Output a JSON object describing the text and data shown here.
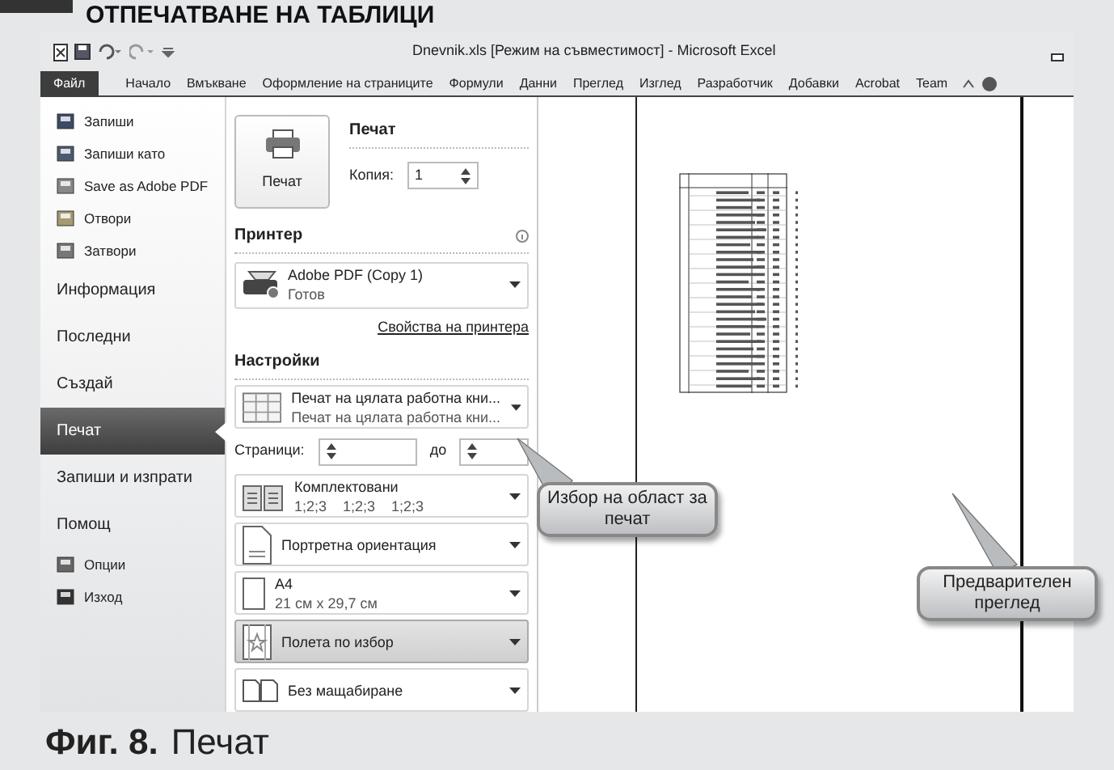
{
  "page_heading": "ОТПЕЧАТВАНЕ НА ТАБЛИЦИ",
  "window": {
    "title": "Dnevnik.xls  [Режим на съвместимост]  -  Microsoft Excel"
  },
  "ribbon_tabs": [
    {
      "label": "Файл",
      "selected": true
    },
    {
      "label": "Начало",
      "selected": false
    },
    {
      "label": "Вмъкване",
      "selected": false
    },
    {
      "label": "Оформление на страниците",
      "selected": false
    },
    {
      "label": "Формули",
      "selected": false
    },
    {
      "label": "Данни",
      "selected": false
    },
    {
      "label": "Преглед",
      "selected": false
    },
    {
      "label": "Изглед",
      "selected": false
    },
    {
      "label": "Разработчик",
      "selected": false
    },
    {
      "label": "Добавки",
      "selected": false
    },
    {
      "label": "Acrobat",
      "selected": false
    },
    {
      "label": "Team",
      "selected": false
    }
  ],
  "sidebar": {
    "items": [
      {
        "label": "Запиши",
        "kind": "command",
        "selected": false
      },
      {
        "label": "Запиши като",
        "kind": "command",
        "selected": false
      },
      {
        "label": "Save as Adobe PDF",
        "kind": "command",
        "selected": false
      },
      {
        "label": "Отвори",
        "kind": "command",
        "selected": false
      },
      {
        "label": "Затвори",
        "kind": "command",
        "selected": false
      },
      {
        "label": "Информация",
        "kind": "section",
        "selected": false
      },
      {
        "label": "Последни",
        "kind": "section",
        "selected": false
      },
      {
        "label": "Създай",
        "kind": "section",
        "selected": false
      },
      {
        "label": "Печат",
        "kind": "section",
        "selected": true
      },
      {
        "label": "Запиши и изпрати",
        "kind": "section",
        "selected": false
      },
      {
        "label": "Помощ",
        "kind": "section",
        "selected": false
      },
      {
        "label": "Опции",
        "kind": "command",
        "selected": false
      },
      {
        "label": "Изход",
        "kind": "command",
        "selected": false
      }
    ]
  },
  "print": {
    "button": "Печат",
    "heading": "Печат",
    "copies_label": "Копия:",
    "copies": "1"
  },
  "printer": {
    "heading": "Принтер",
    "name": "Adobe PDF (Copy 1)",
    "status": "Готов",
    "properties_link": "Свойства на принтера"
  },
  "settings": {
    "heading": "Настройки",
    "items": [
      {
        "kind": "scope",
        "title": "Печат на цялата работна кни...",
        "subtitle": "Печат на цялата работна кни...",
        "selected": false
      },
      {
        "kind": "pages",
        "label": "Страници:",
        "to_label": "до"
      },
      {
        "kind": "collate",
        "title": "Комплектовани",
        "subtitle": "1;2;3    1;2;3    1;2;3",
        "selected": false
      },
      {
        "kind": "orientation",
        "title": "Портретна ориентация",
        "selected": false
      },
      {
        "kind": "paper",
        "title": "A4",
        "subtitle": "21 см x 29,7 см",
        "selected": false
      },
      {
        "kind": "margins",
        "title": "Полета по избор",
        "selected": true
      },
      {
        "kind": "scaling",
        "title": "Без мащабиране",
        "selected": false
      }
    ]
  },
  "callouts": [
    {
      "text": "Избор на област за печат"
    },
    {
      "text": "Предварителен преглед"
    }
  ],
  "caption": {
    "number": "Фиг. 8.",
    "text": "Печат"
  }
}
